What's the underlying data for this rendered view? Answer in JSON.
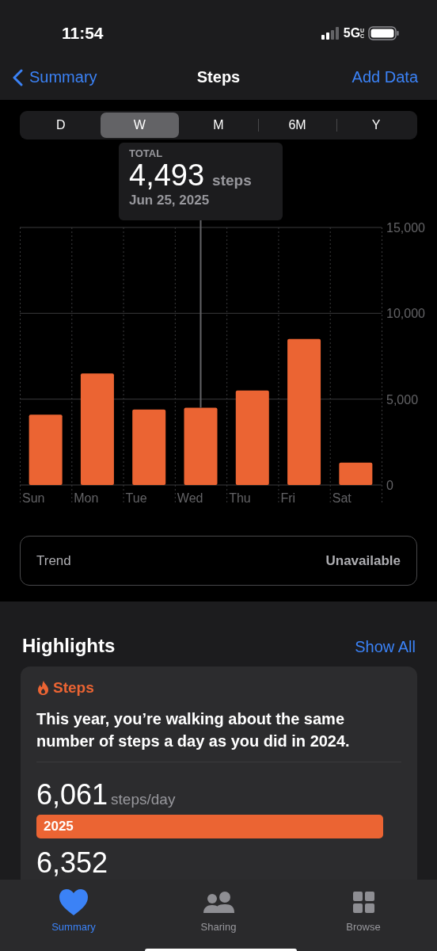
{
  "status_bar": {
    "time": "11:54",
    "network": "5G",
    "network_badge": "UC"
  },
  "nav_bar": {
    "back": "Summary",
    "title": "Steps",
    "action": "Add Data"
  },
  "range_tabs": [
    {
      "label": "D",
      "selected": false
    },
    {
      "label": "W",
      "selected": true
    },
    {
      "label": "M",
      "selected": false
    },
    {
      "label": "6M",
      "selected": false
    },
    {
      "label": "Y",
      "selected": false
    }
  ],
  "tooltip": {
    "label": "TOTAL",
    "value": "4,493",
    "unit": "steps",
    "date": "Jun 25, 2025"
  },
  "chart_data": {
    "type": "bar",
    "categories": [
      "Sun",
      "Mon",
      "Tue",
      "Wed",
      "Thu",
      "Fri",
      "Sat"
    ],
    "series": [
      {
        "color": "#eb6433",
        "values": [
          4100,
          6500,
          4400,
          4500,
          5500,
          8500,
          1300
        ]
      }
    ],
    "ylim": [
      0,
      15000
    ],
    "yticks": [
      {
        "value": 0,
        "label": "0"
      },
      {
        "value": 5000,
        "label": "5,000"
      },
      {
        "value": 10000,
        "label": "10,000"
      },
      {
        "value": 15000,
        "label": "15,000"
      }
    ]
  },
  "trend": {
    "label": "Trend",
    "value": "Unavailable"
  },
  "highlights": {
    "title": "Highlights",
    "action": "Show All",
    "card": {
      "category": "Steps",
      "text": "This year, you’re walking about the same number of steps a day as you did in 2024.",
      "rows": [
        {
          "value": "6,061",
          "unit": "steps/day",
          "year": "2025"
        },
        {
          "value": "6,352"
        }
      ]
    }
  },
  "tab_bar": [
    {
      "label": "Summary",
      "selected": true
    },
    {
      "label": "Sharing",
      "selected": false
    },
    {
      "label": "Browse",
      "selected": false
    }
  ]
}
